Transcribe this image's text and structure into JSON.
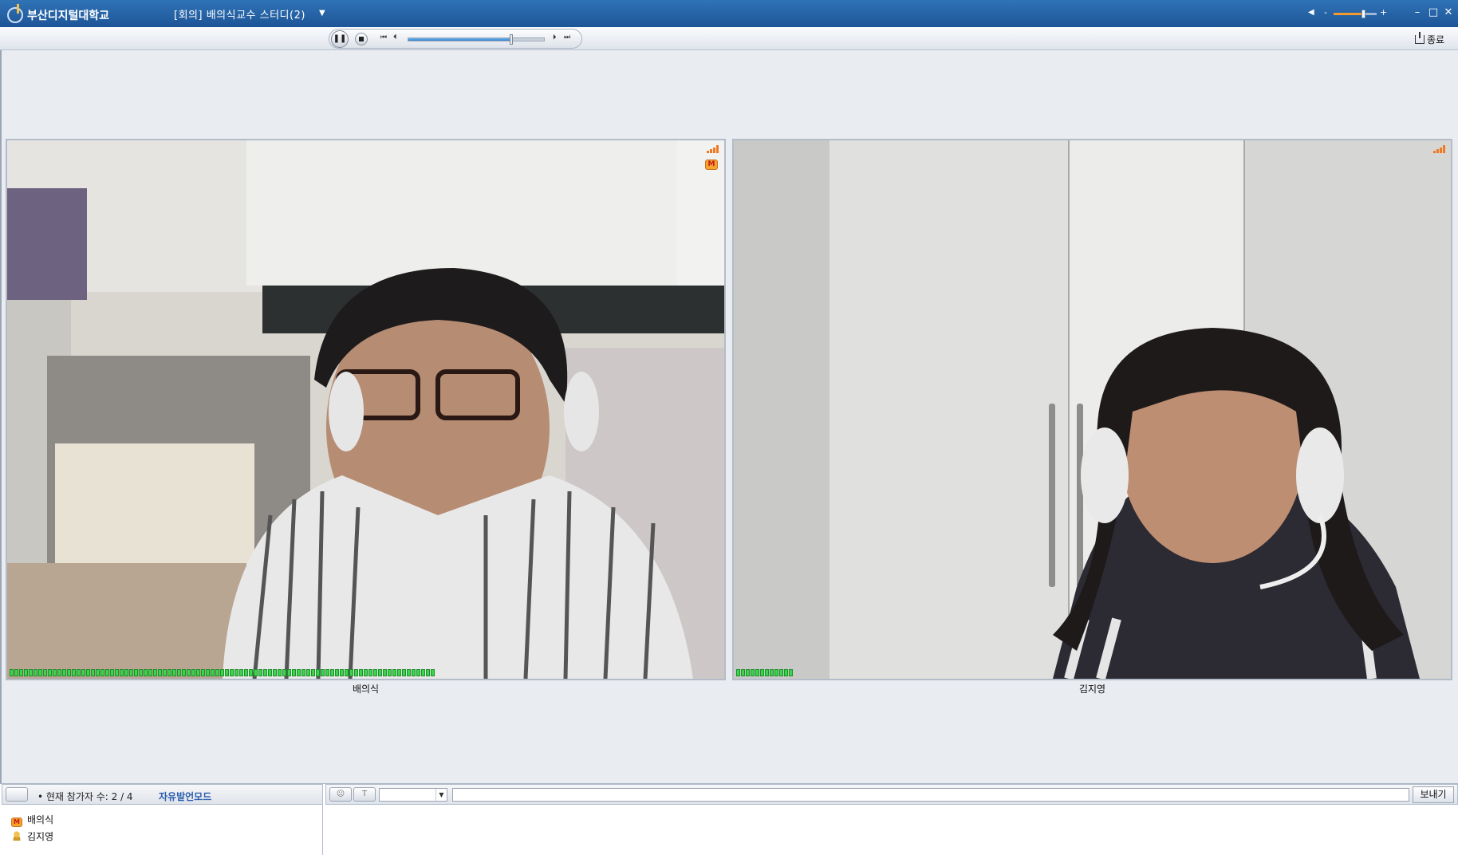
{
  "titlebar": {
    "brand": "부산디지털대학교",
    "meeting_title": "[회의] 배의식교수 스터디(2)",
    "volume_level": 0.7,
    "controls": {
      "minimize": "–",
      "maximize": "□",
      "close": "✕"
    }
  },
  "toolbar": {
    "player_progress": 0.76,
    "pause_icon": "pause-icon",
    "exit_label": "종료"
  },
  "participants_video": [
    {
      "name": "배의식",
      "mic_level": 0.77,
      "role": "moderator"
    },
    {
      "name": "김지영",
      "mic_level": 0.1,
      "role": "participant"
    }
  ],
  "bottom": {
    "participant_count": "• 현재 참가자 수: 2 / 4",
    "mode_label": "자유발언모드",
    "participants": [
      {
        "name": "배의식",
        "icon": "moderator-icon"
      },
      {
        "name": "김지영",
        "icon": "user-icon"
      }
    ],
    "chat": {
      "font_select_value": "",
      "input_value": "",
      "send_label": "보내기"
    }
  },
  "colors": {
    "titlebar": "#2a6aae",
    "accent_orange": "#f29a2e",
    "meter_green": "#3bd44b",
    "mode_blue": "#2c5fae"
  }
}
